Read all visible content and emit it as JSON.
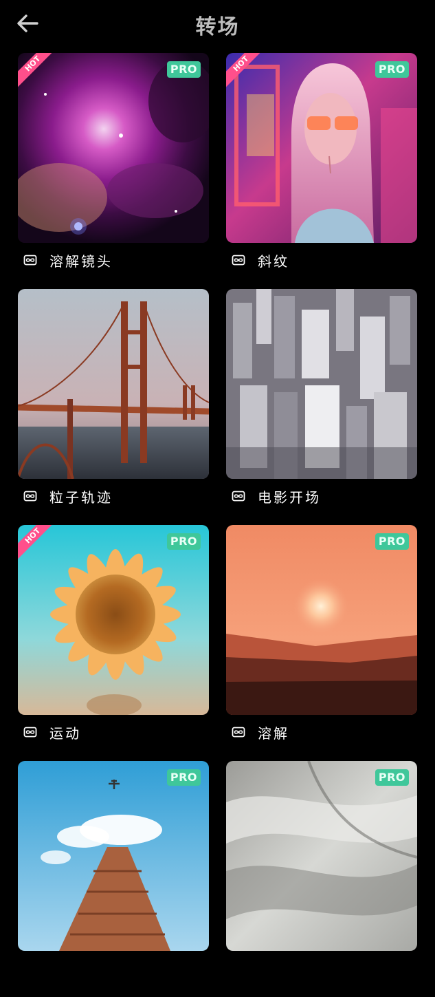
{
  "header": {
    "title": "转场",
    "back_icon": "arrow-left-icon"
  },
  "items": [
    {
      "label": "溶解镜头",
      "pro": "PRO",
      "hot": "HOT",
      "scene": "nebula"
    },
    {
      "label": "斜纹",
      "pro": "PRO",
      "hot": "HOT",
      "scene": "neon-portrait"
    },
    {
      "label": "粒子轨迹",
      "pro": "",
      "hot": "",
      "scene": "bridge"
    },
    {
      "label": "电影开场",
      "pro": "",
      "hot": "",
      "scene": "city"
    },
    {
      "label": "运动",
      "pro": "PRO",
      "hot": "HOT",
      "scene": "sunflower"
    },
    {
      "label": "溶解",
      "pro": "PRO",
      "hot": "",
      "scene": "sunset"
    },
    {
      "label": "",
      "pro": "PRO",
      "hot": "",
      "scene": "tower-sky"
    },
    {
      "label": "",
      "pro": "PRO",
      "hot": "",
      "scene": "fabric"
    }
  ],
  "label_icon": "infinity-loop-icon",
  "colors": {
    "background": "#000000",
    "pro_badge": "#3fc79a",
    "hot_badge": "#ff4f8b",
    "title": "#bdbdbd"
  }
}
